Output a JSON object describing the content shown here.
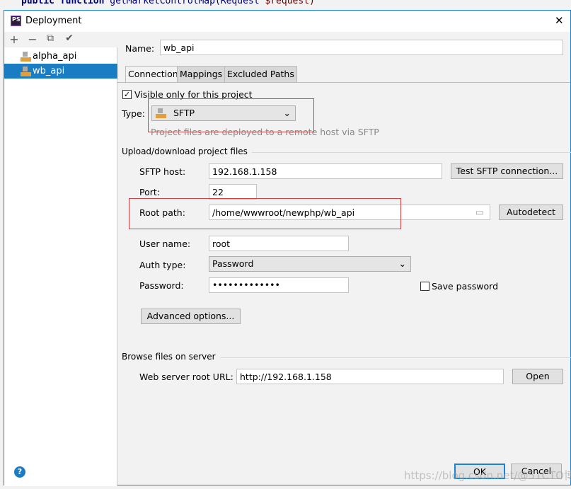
{
  "background_code": {
    "keyword1": "public",
    "keyword2": "function",
    "text": "getMarketControlMap(Request ",
    "var": "$request)"
  },
  "dialog": {
    "title": "Deployment",
    "close": "✕",
    "logo": "PS"
  },
  "sidebar": {
    "toolbar": [
      "+",
      "−",
      "⧉",
      "✔"
    ],
    "items": [
      {
        "label": "alpha_api",
        "selected": false
      },
      {
        "label": "wb_api",
        "selected": true
      }
    ]
  },
  "name": {
    "label": "Name:",
    "value": "wb_api"
  },
  "tabs": [
    {
      "label": "Connection",
      "active": true
    },
    {
      "label": "Mappings"
    },
    {
      "label": "Excluded Paths"
    }
  ],
  "visible_only": {
    "label": "Visible only for this project",
    "checked": true
  },
  "type": {
    "label": "Type:",
    "value": "SFTP",
    "icon_text": "SFTP",
    "hint": "Project files are deployed to a remote host via SFTP"
  },
  "upload_section": "Upload/download project files",
  "sftp_host": {
    "label": "SFTP host:",
    "value": "192.168.1.158",
    "test_button": "Test SFTP connection..."
  },
  "port": {
    "label": "Port:",
    "value": "22"
  },
  "root_path": {
    "label": "Root path:",
    "value": "/home/wwwroot/newphp/wb_api",
    "autodetect": "Autodetect"
  },
  "user_name": {
    "label": "User name:",
    "value": "root"
  },
  "auth_type": {
    "label": "Auth type:",
    "value": "Password"
  },
  "password": {
    "label": "Password:",
    "value": "•••••••••••••",
    "save_label": "Save password",
    "save_checked": false
  },
  "advanced": "Advanced options...",
  "browse_section": "Browse files on server",
  "web_url": {
    "label": "Web server root URL:",
    "value": "http://192.168.1.158",
    "open": "Open"
  },
  "footer": {
    "help": "?",
    "ok": "OK",
    "cancel": "Cancel",
    "watermark": "https://blog.csdn.net/@51CTO博客"
  },
  "colors": {
    "selection": "#1a7dc4",
    "highlight": "#d04040",
    "accent": "#1883d7"
  }
}
